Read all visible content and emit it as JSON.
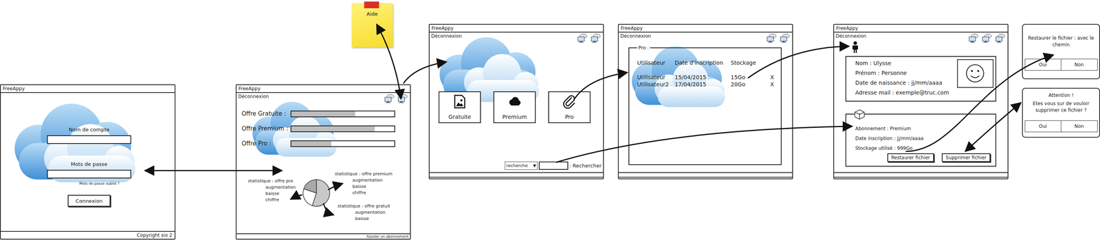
{
  "help_note": {
    "label": "Aide"
  },
  "login": {
    "title": "FreeAppy",
    "fields": [
      {
        "label": "Nom de compte"
      },
      {
        "label": "Mots de passe"
      }
    ],
    "forgot": "Mots de passe oublié ?",
    "button": "Connexion",
    "footer": "Copyright sio 2"
  },
  "dashboard": {
    "title": "FreeAppy",
    "logout": "Déconnexion",
    "offers": [
      {
        "label": "Offre Gratuite :",
        "level": 0.62
      },
      {
        "label": "Offre Premium :",
        "level": 0.81
      },
      {
        "label": "Offre Pro :",
        "level": 0.39
      }
    ],
    "pie": {
      "slices": [
        {
          "value": 55,
          "color": "#c8c8c8"
        },
        {
          "value": 25,
          "color": "#ffffff"
        },
        {
          "value": 20,
          "color": "#a9a9a9"
        }
      ]
    },
    "stats": [
      {
        "lines": [
          "statistique : offre pro",
          "augmentation",
          "baisse",
          "chiffre"
        ]
      },
      {
        "lines": [
          "statistique : offre premium",
          "augmentation",
          "baisse",
          "chiffre"
        ]
      },
      {
        "lines": [
          "statistique : offre gratuit",
          "augmentation",
          "baisse"
        ]
      }
    ],
    "add_link": "Ajouter un abonnement"
  },
  "offers_page": {
    "title": "FreeAppy",
    "logout": "Déconnexion",
    "cards": [
      {
        "label": "Gratuite",
        "kind": "image"
      },
      {
        "label": "Premium",
        "kind": "cloud"
      },
      {
        "label": "Pro",
        "kind": "clip"
      }
    ],
    "search": {
      "select": "recherche",
      "arrow": "▼",
      "label": ": Rechercher"
    }
  },
  "pro_list": {
    "title": "FreeAppy",
    "logout": "Déconnexion",
    "legend": "Pro :",
    "columns": [
      "Utilisateur",
      "Date d'inscription",
      "Stockage"
    ],
    "rows": [
      {
        "cells": [
          "Utilisateur",
          "15/04/2015",
          "15Go"
        ],
        "delete": "X"
      },
      {
        "cells": [
          "Utilisateur2",
          "17/04/2015",
          "20Go"
        ],
        "delete": "X"
      }
    ]
  },
  "profile": {
    "title": "FreeAppy",
    "logout": "Déconnexion",
    "identity": [
      {
        "label": "Nom :",
        "value": "Ulysse"
      },
      {
        "label": "Prénom :",
        "value": "Personne"
      },
      {
        "label": "Date de naissance :",
        "value": "jj/mm/aaaa"
      },
      {
        "label": "Adresse mail :",
        "value": "exemple@truc.com"
      }
    ],
    "subscription": [
      {
        "label": "Abonnement :",
        "value": "Premium"
      },
      {
        "label": "Date inscription :",
        "value": "jj/mm/aaaa"
      },
      {
        "label": "Stockage utilisé :",
        "value": "999Go"
      }
    ],
    "buttons": [
      "Restaurer fichier",
      "Supprimer fichier"
    ]
  },
  "dialogs": [
    {
      "message": "Restaurer le fichier : avec le chemin",
      "buttons": [
        "Oui",
        "Non"
      ]
    },
    {
      "title": "Attention !",
      "message": "Etes vous sur de vouloir supprimer ce fichier ?",
      "buttons": [
        "Oui",
        "Non"
      ]
    }
  ]
}
